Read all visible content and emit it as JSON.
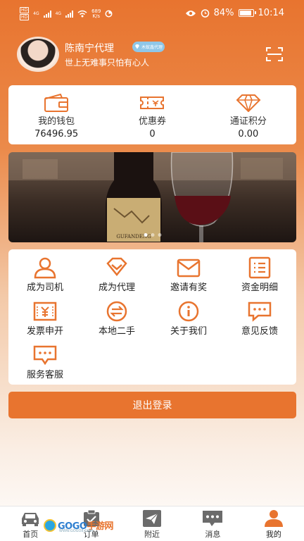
{
  "status_bar": {
    "left": {
      "sim1": "HD",
      "sim2": "HD",
      "net1": "4G",
      "net2": "4G",
      "speed_value": "689",
      "speed_unit": "K/s"
    },
    "right": {
      "battery": "84%",
      "time": "10:14"
    }
  },
  "profile": {
    "name": "陈南宁代理",
    "badge": "木蚁鑫代理",
    "motto": "世上无难事只怕有心人"
  },
  "wallet": [
    {
      "label": "我的钱包",
      "value": "76496.95",
      "icon": "wallet-icon"
    },
    {
      "label": "优惠券",
      "value": "0",
      "icon": "coupon-icon"
    },
    {
      "label": "通证积分",
      "value": "0.00",
      "icon": "diamond-icon"
    }
  ],
  "banner": {
    "bottle_label": "GUFANDENG",
    "dots": 3,
    "active_dot": 0
  },
  "menu": [
    {
      "label": "成为司机",
      "icon": "driver-icon"
    },
    {
      "label": "成为代理",
      "icon": "agent-icon"
    },
    {
      "label": "邀请有奖",
      "icon": "invite-mail-icon"
    },
    {
      "label": "资金明细",
      "icon": "funds-list-icon"
    },
    {
      "label": "发票申开",
      "icon": "invoice-icon"
    },
    {
      "label": "本地二手",
      "icon": "exchange-icon"
    },
    {
      "label": "关于我们",
      "icon": "info-icon"
    },
    {
      "label": "意见反馈",
      "icon": "feedback-icon"
    },
    {
      "label": "服务客服",
      "icon": "service-chat-icon"
    }
  ],
  "logout_label": "退出登录",
  "tabs": [
    {
      "label": "首页",
      "icon": "car-icon"
    },
    {
      "label": "订单",
      "icon": "order-icon"
    },
    {
      "label": "附近",
      "icon": "send-icon"
    },
    {
      "label": "消息",
      "icon": "message-icon"
    },
    {
      "label": "我的",
      "icon": "user-icon"
    }
  ],
  "watermark": {
    "text_blue": "GOGO",
    "text_orange": "手游网",
    "sub": "WWW.GOGO8.COM"
  },
  "colors": {
    "accent": "#e8742f",
    "icon_gray": "#6b6b6b"
  }
}
